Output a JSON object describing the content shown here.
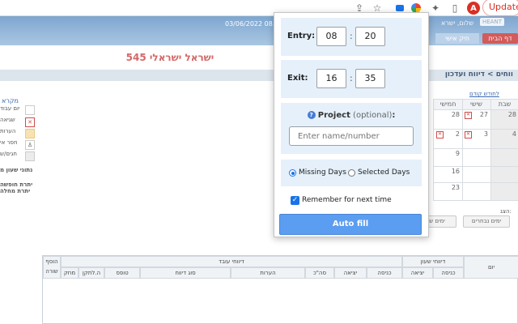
{
  "browser": {
    "profile_initial": "A",
    "update_label": "Update",
    "accent": "#d93025"
  },
  "header": {
    "date": "03/06/2022 08.",
    "greeting": "שלום, ישרא",
    "logo": "HEANT",
    "home_button": "דף הבית",
    "personal_tab": "תיק אישי",
    "header_color": "#7ea6cf"
  },
  "employee": {
    "name": "ישראל ישראלי 545",
    "color": "#d46868"
  },
  "breadcrumb": "ווחים > דיווח ועדכון",
  "calendar": {
    "prev_month_link": "לחודש קודם",
    "weekdays": [
      "שבת",
      "שישי",
      "חמישי"
    ],
    "rows": [
      [
        "28",
        "27",
        "28"
      ],
      [
        "4",
        "3",
        "2"
      ],
      [
        "",
        "",
        "9"
      ],
      [
        "",
        "",
        "16"
      ],
      [
        "",
        "",
        "23"
      ]
    ]
  },
  "legend": {
    "title": "מקרא",
    "items": [
      "יום עבוד",
      "שגיאה",
      "הערות",
      "חסר אי",
      "חגים/ש"
    ]
  },
  "notes": [
    "נתוני שעון מ",
    "יתרת חופשה",
    "יתרת מחלה"
  ],
  "view": {
    "label": "הצג:",
    "selected_days_button": "ימים נבחרים",
    "weekly_button": "ימים שב"
  },
  "table": {
    "group_work": "דיווחי עובד",
    "group_clock": "דיווחי שעון",
    "group_add": "הוסף",
    "day": "יום",
    "clock_cols": [
      "כניסה",
      "יציאה"
    ],
    "work_cols": [
      "כניסה",
      "יציאה",
      "סה\"כ",
      "הערות",
      "סוג דיווח",
      "טופס",
      "ה.לתקן",
      "מחק"
    ],
    "add_row": "שורה"
  },
  "popup": {
    "entry_label": "Entry:",
    "entry_hour": "08",
    "entry_minute": "20",
    "exit_label": "Exit:",
    "exit_hour": "16",
    "exit_minute": "35",
    "colon": ":",
    "project_label": "Project",
    "project_optional": "(optional)",
    "project_colon": ":",
    "project_help": "?",
    "project_placeholder": "Enter name/number",
    "mode_missing": "Missing Days",
    "mode_selected": "Selected Days",
    "mode_value": "Missing Days",
    "remember_label": "Remember for next time",
    "remember_checked": true,
    "autofill_label": "Auto fill",
    "panel_color": "#e5f0fa",
    "button_color": "#5b9df0"
  }
}
